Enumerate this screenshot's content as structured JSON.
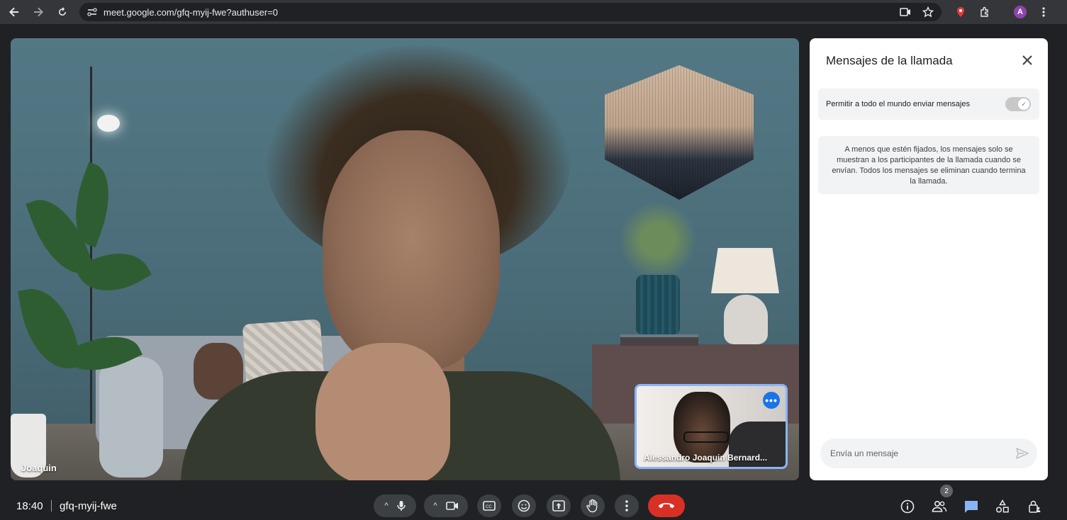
{
  "browser": {
    "url": "meet.google.com/gfq-myij-fwe?authuser=0",
    "profile_initial": "A",
    "colors": {
      "chrome_bg": "#35363a",
      "omnibox_bg": "#202124",
      "profile": "#8e44ad"
    }
  },
  "stage": {
    "main_participant": "Joaquin",
    "pip_participant": "Alessandro Joaquin Bernard...",
    "pip_more_label": "•••"
  },
  "chat_panel": {
    "title": "Mensajes de la llamada",
    "close_icon": "close-icon",
    "toggle_label": "Permitir a todo el mundo enviar mensajes",
    "toggle_on": true,
    "info_text": "A menos que estén fijados, los mensajes solo se muestran a los participantes de la llamada cuando se envían. Todos los mensajes se eliminan cuando termina la llamada.",
    "input_placeholder": "Envía un mensaje"
  },
  "toolbar": {
    "time": "18:40",
    "meeting_code": "gfq-myij-fwe",
    "participant_count": "2",
    "hangup_color": "#d93025",
    "chat_active_color": "#8ab4f8"
  }
}
